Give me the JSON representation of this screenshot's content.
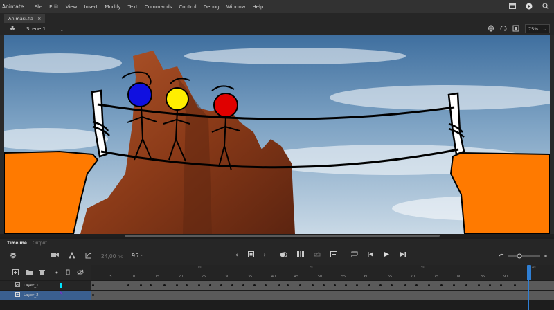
{
  "app": {
    "name": "Animate"
  },
  "menu": [
    "File",
    "Edit",
    "View",
    "Insert",
    "Modify",
    "Text",
    "Commands",
    "Control",
    "Debug",
    "Window",
    "Help"
  ],
  "document": {
    "tab_label": "Animasi.fla",
    "close_glyph": "×"
  },
  "scene": {
    "label": "Scene 1"
  },
  "zoom": {
    "value": "75%"
  },
  "timeline": {
    "tabs": {
      "active": "Timeline",
      "other": "Output"
    },
    "fps": "24,00",
    "fps_unit": "FPS",
    "current_frame": "95",
    "frame_unit": "F",
    "second_marks": [
      "1s",
      "2s",
      "3s",
      "4s"
    ],
    "frame_labels": [
      "5",
      "10",
      "15",
      "20",
      "25",
      "30",
      "35",
      "40",
      "45",
      "50",
      "55",
      "60",
      "65",
      "70",
      "75",
      "80",
      "85",
      "90"
    ],
    "playhead_frame": 95
  },
  "layers": [
    {
      "name": "Layer_1",
      "color": "#00e5ff",
      "selected": false
    },
    {
      "name": "Layer_2",
      "color": "#b000ff",
      "selected": true
    }
  ],
  "colors": {
    "accent": "#2f7fd4",
    "ground": "#ff7a00",
    "char_blue": "#1010e0",
    "char_yellow": "#ffee00",
    "char_red": "#e00000"
  }
}
